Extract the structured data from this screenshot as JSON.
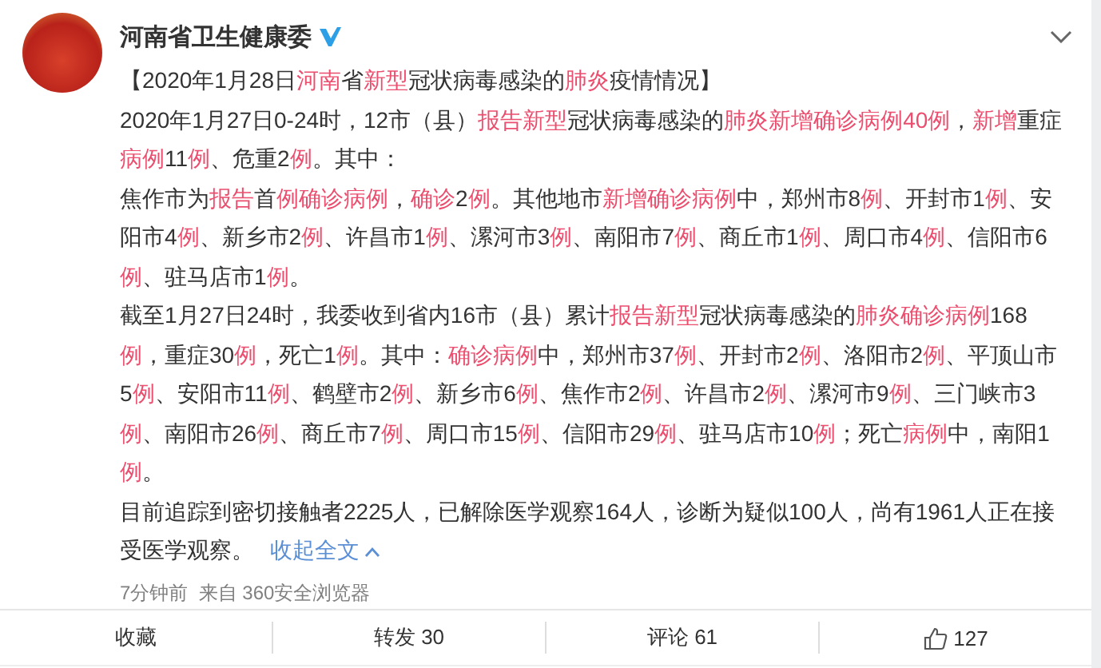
{
  "post": {
    "author": "河南省卫生健康委",
    "verified": true,
    "paragraphs": [
      [
        [
          "【2020年1月28日",
          false
        ],
        [
          "河南",
          true
        ],
        [
          "省",
          false
        ],
        [
          "新型",
          true
        ],
        [
          "冠状病毒感染的",
          false
        ],
        [
          "肺炎",
          true
        ],
        [
          "疫情情况】",
          false
        ]
      ],
      [
        [
          "2020年1月27日0-24时，12市（县）",
          false
        ],
        [
          "报告新型",
          true
        ],
        [
          "冠状病毒感染的",
          false
        ],
        [
          "肺炎新增确诊病例40例",
          true
        ],
        [
          "，",
          false
        ],
        [
          "新增",
          true
        ],
        [
          "重症",
          false
        ],
        [
          "病例",
          true
        ],
        [
          "11",
          false
        ],
        [
          "例",
          true
        ],
        [
          "、危重2",
          false
        ],
        [
          "例",
          true
        ],
        [
          "。其中：",
          false
        ]
      ],
      [
        [
          "焦作市为",
          false
        ],
        [
          "报告",
          true
        ],
        [
          "首",
          false
        ],
        [
          "例确诊病例",
          true
        ],
        [
          "，",
          false
        ],
        [
          "确诊",
          true
        ],
        [
          "2",
          false
        ],
        [
          "例",
          true
        ],
        [
          "。其他地市",
          false
        ],
        [
          "新增确诊病例",
          true
        ],
        [
          "中，郑州市8",
          false
        ],
        [
          "例",
          true
        ],
        [
          "、开封市1",
          false
        ],
        [
          "例",
          true
        ],
        [
          "、安阳市4",
          false
        ],
        [
          "例",
          true
        ],
        [
          "、新乡市2",
          false
        ],
        [
          "例",
          true
        ],
        [
          "、许昌市1",
          false
        ],
        [
          "例",
          true
        ],
        [
          "、漯河市3",
          false
        ],
        [
          "例",
          true
        ],
        [
          "、南阳市7",
          false
        ],
        [
          "例",
          true
        ],
        [
          "、商丘市1",
          false
        ],
        [
          "例",
          true
        ],
        [
          "、周口市4",
          false
        ],
        [
          "例",
          true
        ],
        [
          "、信阳市6",
          false
        ],
        [
          "例",
          true
        ],
        [
          "、驻马店市1",
          false
        ],
        [
          "例",
          true
        ],
        [
          "。",
          false
        ]
      ],
      [
        [
          "截至1月27日24时，我委收到省内16市（县）累计",
          false
        ],
        [
          "报告新型",
          true
        ],
        [
          "冠状病毒感染的",
          false
        ],
        [
          "肺炎确诊病例",
          true
        ],
        [
          "168",
          false
        ],
        [
          "例",
          true
        ],
        [
          "，重症30",
          false
        ],
        [
          "例",
          true
        ],
        [
          "，死亡1",
          false
        ],
        [
          "例",
          true
        ],
        [
          "。其中：",
          false
        ],
        [
          "确诊病例",
          true
        ],
        [
          "中，郑州市37",
          false
        ],
        [
          "例",
          true
        ],
        [
          "、开封市2",
          false
        ],
        [
          "例",
          true
        ],
        [
          "、洛阳市2",
          false
        ],
        [
          "例",
          true
        ],
        [
          "、平顶山市5",
          false
        ],
        [
          "例",
          true
        ],
        [
          "、安阳市11",
          false
        ],
        [
          "例",
          true
        ],
        [
          "、鹤壁市2",
          false
        ],
        [
          "例",
          true
        ],
        [
          "、新乡市6",
          false
        ],
        [
          "例",
          true
        ],
        [
          "、焦作市2",
          false
        ],
        [
          "例",
          true
        ],
        [
          "、许昌市2",
          false
        ],
        [
          "例",
          true
        ],
        [
          "、漯河市9",
          false
        ],
        [
          "例",
          true
        ],
        [
          "、三门峡市3",
          false
        ],
        [
          "例",
          true
        ],
        [
          "、南阳市26",
          false
        ],
        [
          "例",
          true
        ],
        [
          "、商丘市7",
          false
        ],
        [
          "例",
          true
        ],
        [
          "、周口市15",
          false
        ],
        [
          "例",
          true
        ],
        [
          "、信阳市29",
          false
        ],
        [
          "例",
          true
        ],
        [
          "、驻马店市10",
          false
        ],
        [
          "例",
          true
        ],
        [
          "；死亡",
          false
        ],
        [
          "病例",
          true
        ],
        [
          "中，南阳1",
          false
        ],
        [
          "例",
          true
        ],
        [
          "。",
          false
        ]
      ],
      [
        [
          "目前追踪到密切接触者2225人，已解除医学观察164人，诊断为疑似100人，尚有1961人正在接受医学观察。",
          false
        ]
      ]
    ],
    "collapse_link": "收起全文",
    "meta": "7分钟前  来自 360安全浏览器"
  },
  "actions": [
    {
      "kind": "text",
      "label": "收藏"
    },
    {
      "kind": "text",
      "label": "转发 30"
    },
    {
      "kind": "text",
      "label": "评论 61"
    },
    {
      "kind": "like",
      "label": "127"
    }
  ]
}
